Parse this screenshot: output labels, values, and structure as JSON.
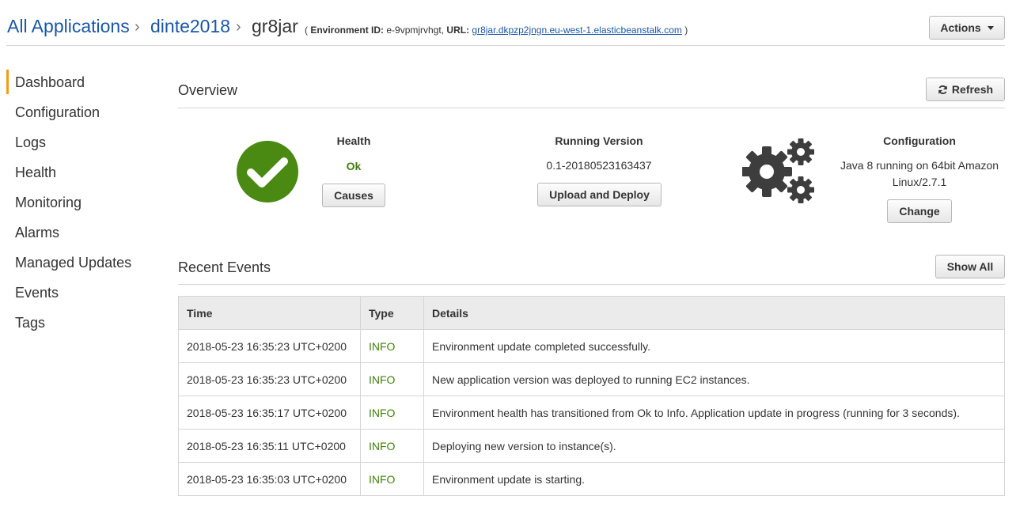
{
  "breadcrumb": {
    "all_apps": "All Applications",
    "app": "dinte2018",
    "env": "gr8jar",
    "env_id_label": "Environment ID:",
    "env_id": "e-9vpmjrvhgt,",
    "url_label": "URL:",
    "url": "gr8jar.dkpzp2jngn.eu-west-1.elasticbeanstalk.com",
    "open_paren": "(",
    "close_paren": ")"
  },
  "actions_label": "Actions",
  "sidebar": {
    "items": [
      {
        "label": "Dashboard"
      },
      {
        "label": "Configuration"
      },
      {
        "label": "Logs"
      },
      {
        "label": "Health"
      },
      {
        "label": "Monitoring"
      },
      {
        "label": "Alarms"
      },
      {
        "label": "Managed Updates"
      },
      {
        "label": "Events"
      },
      {
        "label": "Tags"
      }
    ]
  },
  "overview": {
    "title": "Overview",
    "refresh_label": "Refresh",
    "health": {
      "title": "Health",
      "status": "Ok",
      "button": "Causes",
      "status_color": "#3f7f0b"
    },
    "version": {
      "title": "Running Version",
      "value": "0.1-20180523163437",
      "button": "Upload and Deploy"
    },
    "config": {
      "title": "Configuration",
      "line1": "Java 8 running on 64bit Amazon",
      "line2": "Linux/2.7.1",
      "button": "Change"
    }
  },
  "events": {
    "title": "Recent Events",
    "show_all_label": "Show All",
    "columns": [
      "Time",
      "Type",
      "Details"
    ],
    "rows": [
      {
        "time": "2018-05-23 16:35:23 UTC+0200",
        "type": "INFO",
        "details": "Environment update completed successfully."
      },
      {
        "time": "2018-05-23 16:35:23 UTC+0200",
        "type": "INFO",
        "details": "New application version was deployed to running EC2 instances."
      },
      {
        "time": "2018-05-23 16:35:17 UTC+0200",
        "type": "INFO",
        "details": "Environment health has transitioned from Ok to Info. Application update in progress (running for 3 seconds)."
      },
      {
        "time": "2018-05-23 16:35:11 UTC+0200",
        "type": "INFO",
        "details": "Deploying new version to instance(s)."
      },
      {
        "time": "2018-05-23 16:35:03 UTC+0200",
        "type": "INFO",
        "details": "Environment update is starting."
      }
    ]
  },
  "colors": {
    "link": "#1a56a8",
    "accent": "#f39c12",
    "ok_green": "#3f7f0b",
    "health_icon": "#4a8a12"
  }
}
